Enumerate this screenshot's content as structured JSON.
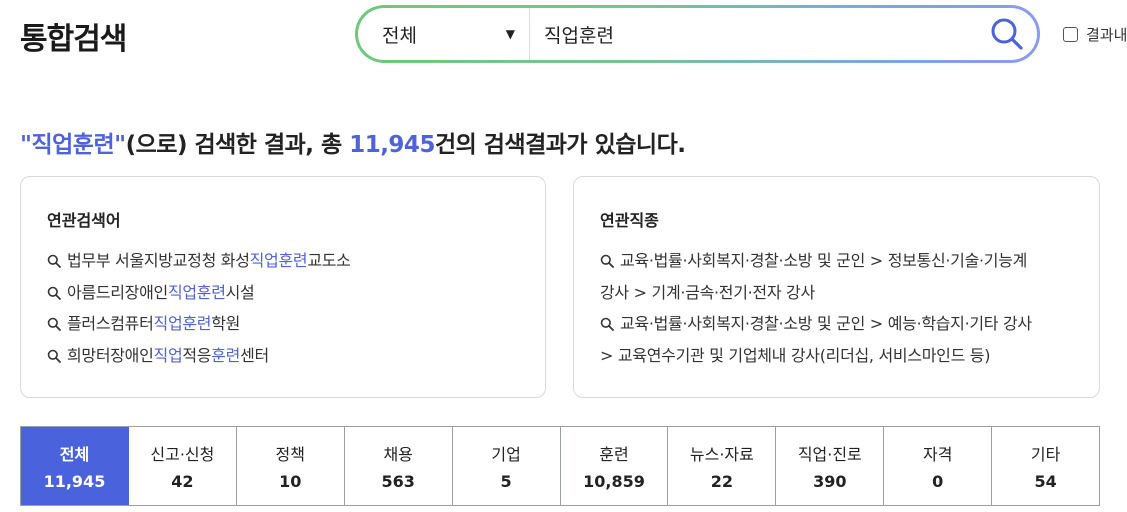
{
  "header": {
    "title": "통합검색"
  },
  "search": {
    "scope_selected": "전체",
    "query": "직업훈련",
    "result_check_label": "결과내"
  },
  "summary": {
    "quote_open": "\"",
    "keyword": "직업훈련",
    "quote_close": "\"",
    "middle": "(으로) 검색한 결과, 총 ",
    "count": "11,945",
    "tail": "건의 검색결과가 있습니다."
  },
  "related_keywords": {
    "title": "연관검색어",
    "items": [
      {
        "pre": "법무부 서울지방교정청 화성",
        "hl": "직업훈련",
        "post": "교도소"
      },
      {
        "pre": "아름드리장애인",
        "hl": "직업훈련",
        "post": "시설"
      },
      {
        "pre": "플러스컴퓨터",
        "hl": "직업훈련",
        "post": "학원"
      },
      {
        "pre": "희망터장애인",
        "hl": "직업",
        "mid": "적응",
        "hl2": "훈련",
        "post": "센터"
      }
    ]
  },
  "related_jobs": {
    "title": "연관직종",
    "items": [
      {
        "line1": "교육·법률·사회복지·경찰·소방 및 군인 > 정보통신·기술·기능계",
        "line2": "강사 > 기계·금속·전기·전자 강사"
      },
      {
        "line1": "교육·법률·사회복지·경찰·소방 및 군인 > 예능·학습지·기타 강사",
        "line2": "> 교육연수기관 및 기업체내 강사(리더십, 서비스마인드 등)"
      }
    ]
  },
  "tabs": [
    {
      "label": "전체",
      "count": "11,945",
      "active": true
    },
    {
      "label": "신고·신청",
      "count": "42"
    },
    {
      "label": "정책",
      "count": "10"
    },
    {
      "label": "채용",
      "count": "563"
    },
    {
      "label": "기업",
      "count": "5"
    },
    {
      "label": "훈련",
      "count": "10,859"
    },
    {
      "label": "뉴스·자료",
      "count": "22"
    },
    {
      "label": "직업·진로",
      "count": "390"
    },
    {
      "label": "자격",
      "count": "0"
    },
    {
      "label": "기타",
      "count": "54"
    }
  ],
  "colors": {
    "accent": "#4f63d8",
    "tab_active": "#4a63dc",
    "gradient_start": "#6cc97a",
    "gradient_end": "#8a9cf0"
  },
  "icons": {
    "search": "search-icon",
    "dropdown": "caret-down-icon"
  }
}
